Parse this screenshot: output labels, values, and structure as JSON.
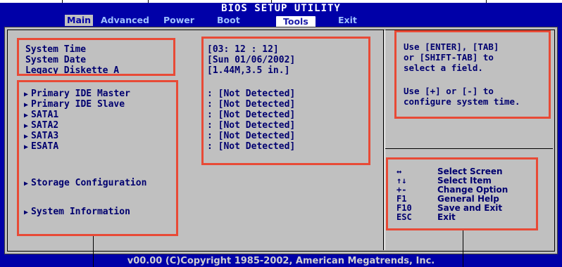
{
  "title": "BIOS SETUP UTILITY",
  "menu": [
    "Main",
    "Advanced",
    "Power",
    "Boot",
    "Tools",
    "Exit"
  ],
  "fields": [
    {
      "label": "System Time",
      "value": "[03: 12 : 12]"
    },
    {
      "label": "System Date",
      "value": "[Sun 01/06/2002]"
    },
    {
      "label": "Legacy Diskette A",
      "value": "[1.44M,3.5 in.]"
    }
  ],
  "devices": [
    {
      "label": "Primary IDE Master",
      "value": ": [Not Detected]"
    },
    {
      "label": "Primary IDE Slave",
      "value": ": [Not Detected]"
    },
    {
      "label": "SATA1",
      "value": ": [Not Detected]"
    },
    {
      "label": "SATA2",
      "value": ": [Not Detected]"
    },
    {
      "label": "SATA3",
      "value": ": [Not Detected]"
    },
    {
      "label": "ESATA",
      "value": ": [Not Detected]"
    }
  ],
  "submenus": [
    "Storage Configuration",
    "System Information"
  ],
  "help": {
    "line1": "Use [ENTER], [TAB]",
    "line2": "or [SHIFT-TAB] to",
    "line3": "select a field.",
    "line4": "Use [+] or [-] to",
    "line5": "configure system time."
  },
  "keys": [
    {
      "key": "↔",
      "desc": "Select Screen"
    },
    {
      "key": "↑↓",
      "desc": "Select Item"
    },
    {
      "key": "+-",
      "desc": "Change Option"
    },
    {
      "key": "F1",
      "desc": "General Help"
    },
    {
      "key": "F10",
      "desc": "Save and Exit"
    },
    {
      "key": "ESC",
      "desc": "Exit"
    }
  ],
  "footer": "v00.00 (C)Copyright 1985-2002, American Megatrends, Inc.",
  "colors": {
    "bios_blue": "#0000a8",
    "panel_gray": "#c0c0c0",
    "highlight_red": "#e84a36"
  }
}
